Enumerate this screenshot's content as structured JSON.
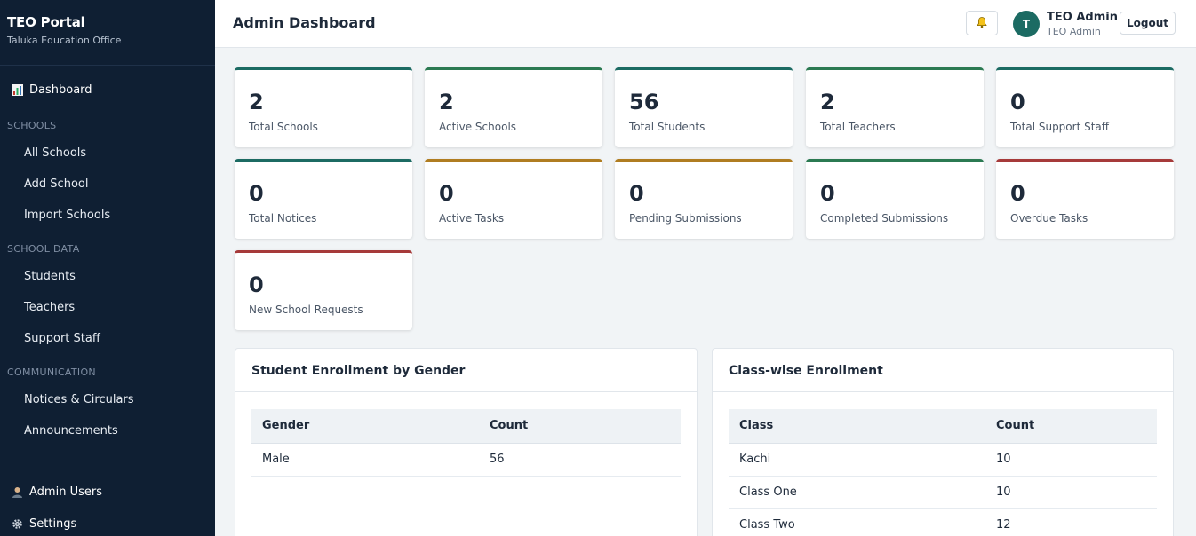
{
  "sidebar": {
    "brand_title": "TEO Portal",
    "brand_subtitle": "Taluka Education Office",
    "dashboard": "Dashboard",
    "sections": [
      {
        "label": "SCHOOLS",
        "items": [
          "All Schools",
          "Add School",
          "Import Schools"
        ]
      },
      {
        "label": "SCHOOL DATA",
        "items": [
          "Students",
          "Teachers",
          "Support Staff"
        ]
      },
      {
        "label": "COMMUNICATION",
        "items": [
          "Notices & Circulars",
          "Announcements"
        ]
      }
    ],
    "admin_users": "Admin Users",
    "settings": "Settings"
  },
  "header": {
    "title": "Admin Dashboard",
    "avatar_letter": "T",
    "user_name": "TEO Admin",
    "user_role": "TEO Admin",
    "logout": "Logout"
  },
  "stats": [
    {
      "value": "2",
      "label": "Total Schools",
      "color": "teal"
    },
    {
      "value": "2",
      "label": "Active Schools",
      "color": "green"
    },
    {
      "value": "56",
      "label": "Total Students",
      "color": "teal"
    },
    {
      "value": "2",
      "label": "Total Teachers",
      "color": "green"
    },
    {
      "value": "0",
      "label": "Total Support Staff",
      "color": "teal"
    },
    {
      "value": "0",
      "label": "Total Notices",
      "color": "teal"
    },
    {
      "value": "0",
      "label": "Active Tasks",
      "color": "amber"
    },
    {
      "value": "0",
      "label": "Pending Submissions",
      "color": "amber"
    },
    {
      "value": "0",
      "label": "Completed Submissions",
      "color": "green"
    },
    {
      "value": "0",
      "label": "Overdue Tasks",
      "color": "red"
    },
    {
      "value": "0",
      "label": "New School Requests",
      "color": "red"
    }
  ],
  "gender_panel": {
    "title": "Student Enrollment by Gender",
    "headers": [
      "Gender",
      "Count"
    ],
    "rows": [
      [
        "Male",
        "56"
      ]
    ]
  },
  "class_panel": {
    "title": "Class-wise Enrollment",
    "headers": [
      "Class",
      "Count"
    ],
    "rows": [
      [
        "Kachi",
        "10"
      ],
      [
        "Class One",
        "10"
      ],
      [
        "Class Two",
        "12"
      ]
    ]
  },
  "colors": {
    "sidebar_bg": "#0f1f33",
    "teal": "#1c6b63",
    "green": "#2b7a52",
    "amber": "#b07d21",
    "red": "#a63a3a"
  }
}
